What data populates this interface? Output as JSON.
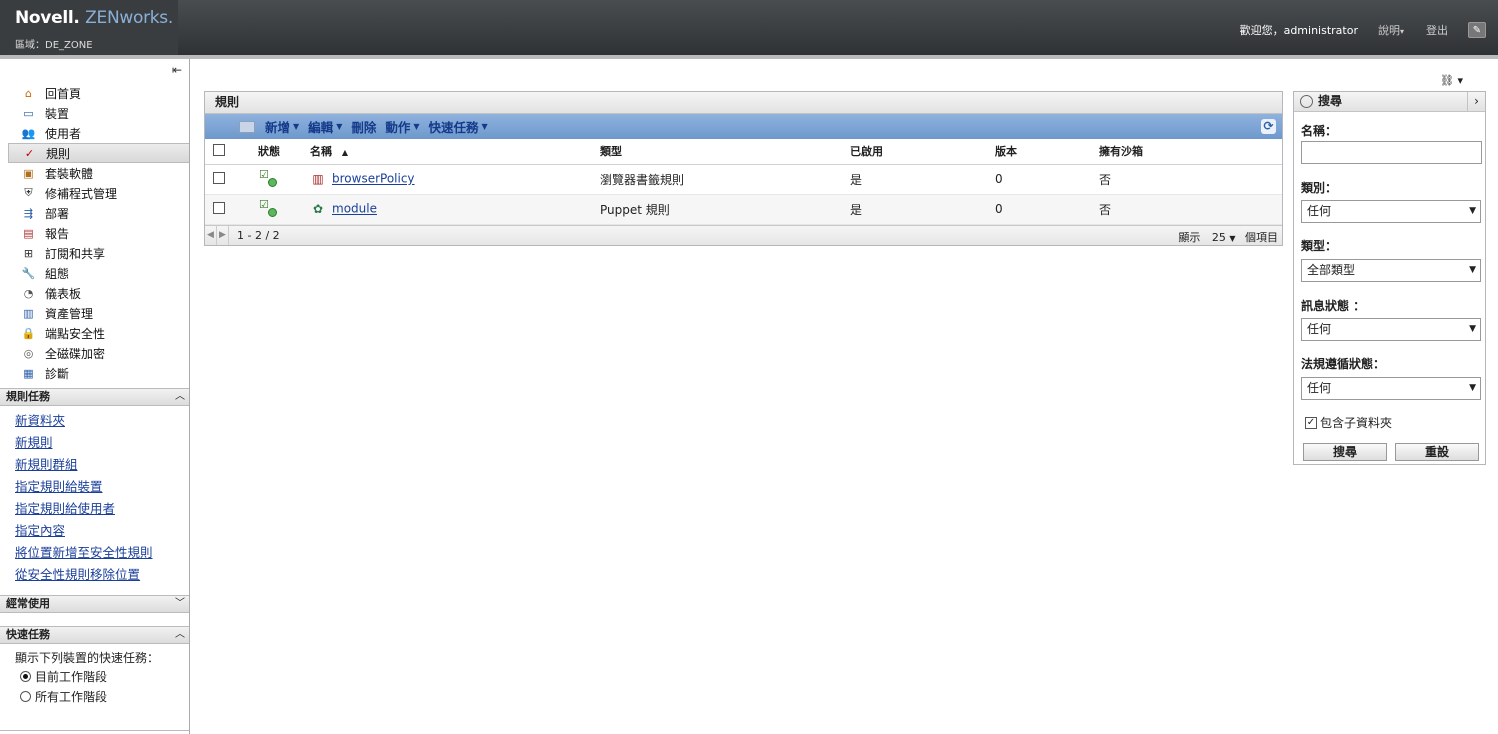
{
  "header": {
    "brand_novell": "Novell.",
    "brand_zen": "ZENworks.",
    "zone": "區域：DE_ZONE",
    "welcome": "歡迎您，administrator",
    "help": "說明",
    "logout": "登出"
  },
  "sidebar": {
    "nav": [
      {
        "label": "回首頁",
        "icon": "home-icon"
      },
      {
        "label": "裝置",
        "icon": "devices-icon"
      },
      {
        "label": "使用者",
        "icon": "users-icon"
      },
      {
        "label": "規則",
        "icon": "policies-icon"
      },
      {
        "label": "套裝軟體",
        "icon": "bundles-icon"
      },
      {
        "label": "修補程式管理",
        "icon": "patch-icon"
      },
      {
        "label": "部署",
        "icon": "deployment-icon"
      },
      {
        "label": "報告",
        "icon": "reports-icon"
      },
      {
        "label": "訂閱和共享",
        "icon": "subscriptions-icon"
      },
      {
        "label": "組態",
        "icon": "configuration-icon"
      },
      {
        "label": "儀表板",
        "icon": "dashboard-icon"
      },
      {
        "label": "資產管理",
        "icon": "asset-icon"
      },
      {
        "label": "端點安全性",
        "icon": "endpoint-security-icon"
      },
      {
        "label": "全磁碟加密",
        "icon": "encryption-icon"
      },
      {
        "label": "診斷",
        "icon": "diagnostics-icon"
      }
    ],
    "policy_tasks_title": "規則任務",
    "policy_tasks": [
      "新資料夾",
      "新規則",
      "新規則群組",
      "指定規則給裝置",
      "指定規則給使用者",
      "指定內容",
      "將位置新增至安全性規則",
      "從安全性規則移除位置"
    ],
    "frequent_title": "經常使用",
    "quick_title": "快速任務",
    "quick_label": "顯示下列裝置的快速任務：",
    "quick_options": [
      "目前工作階段",
      "所有工作階段"
    ]
  },
  "panel": {
    "title": "規則",
    "toolbar": {
      "new": "新增",
      "edit": "編輯",
      "delete": "刪除",
      "action": "動作",
      "quick": "快速任務"
    },
    "columns": {
      "status": "狀態",
      "name": "名稱",
      "type": "類型",
      "enabled": "已啟用",
      "version": "版本",
      "sandbox": "擁有沙箱"
    },
    "rows": [
      {
        "name": "browserPolicy",
        "type": "瀏覽器書籤規則",
        "enabled": "是",
        "version": "0",
        "sandbox": "否"
      },
      {
        "name": "module",
        "type": "Puppet 規則",
        "enabled": "是",
        "version": "0",
        "sandbox": "否"
      }
    ],
    "pager": {
      "range": "1 - 2 / 2",
      "show": "顯示",
      "count": "25",
      "items": "個項目"
    }
  },
  "search": {
    "title": "搜尋",
    "name_label": "名稱：",
    "name_value": "",
    "category_label": "類別：",
    "category_value": "任何",
    "type_label": "類型：",
    "type_value": "全部類型",
    "message_label": "訊息狀態 ：",
    "message_value": "任何",
    "compliance_label": "法規遵循狀態：",
    "compliance_value": "任何",
    "include_subfolders": "包含子資料夾",
    "search_button": "搜尋",
    "reset_button": "重設"
  }
}
